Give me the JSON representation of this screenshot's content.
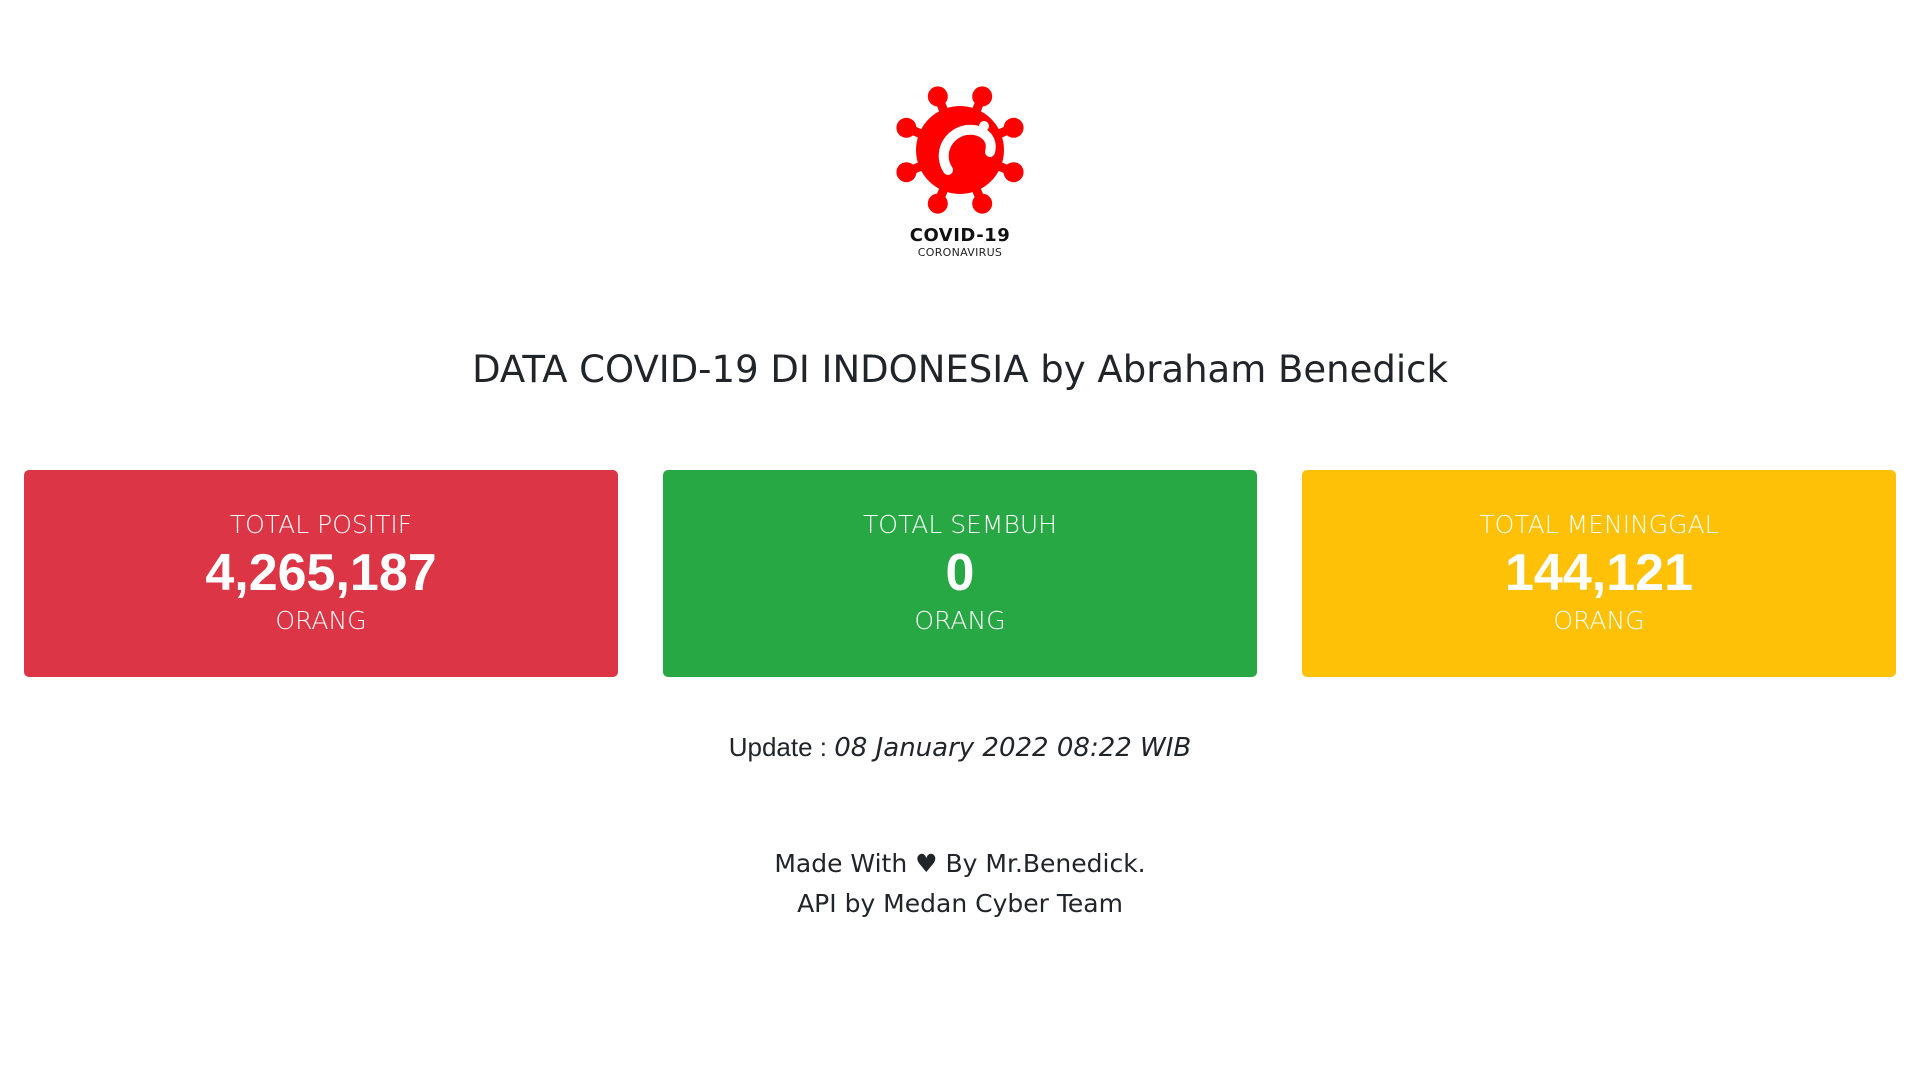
{
  "logo": {
    "title": "COVID-19",
    "subtitle": "CORONAVIRUS",
    "icon": "virus-icon",
    "color": "#ff0000"
  },
  "heading": "DATA COVID-19 DI INDONESIA by Abraham Benedick",
  "cards": [
    {
      "label": "TOTAL POSITIF",
      "value": "4,265,187",
      "unit": "ORANG",
      "color": "#dc3545"
    },
    {
      "label": "TOTAL SEMBUH",
      "value": "0",
      "unit": "ORANG",
      "color": "#28a745"
    },
    {
      "label": "TOTAL MENINGGAL",
      "value": "144,121",
      "unit": "ORANG",
      "color": "#ffc107"
    }
  ],
  "update": {
    "label": "Update :",
    "value": "08 January 2022 08:22 WIB"
  },
  "footer": {
    "line1": "Made With ♥ By Mr.Benedick.",
    "line2": "API by Medan Cyber Team"
  }
}
